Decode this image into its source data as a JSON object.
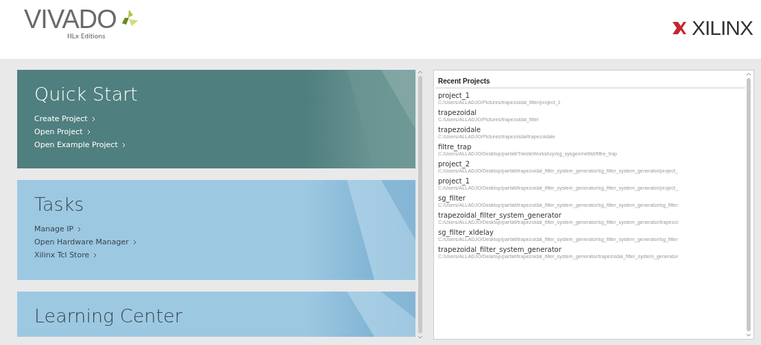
{
  "header": {
    "product": "VIVADO",
    "edition": "HLx Editions",
    "company": "XILINX"
  },
  "sections": [
    {
      "title": "Quick Start",
      "kind": "dark",
      "links": [
        "Create Project",
        "Open Project",
        "Open Example Project"
      ]
    },
    {
      "title": "Tasks",
      "kind": "light",
      "links": [
        "Manage IP",
        "Open Hardware Manager",
        "Xilinx Tcl Store"
      ]
    },
    {
      "title": "Learning Center",
      "kind": "light"
    }
  ],
  "recent_projects": {
    "title": "Recent Projects",
    "items": [
      {
        "name": "project_1",
        "path": "C:/Users/ALLADJO/Pictures/trapezoidal_filter/project_1"
      },
      {
        "name": "trapezoidal",
        "path": "C:/Users/ALLADJO/Pictures/trapezoidal_filter"
      },
      {
        "name": "trapezoidale",
        "path": "C:/Users/ALLADJO/Pictures/trapezoidal/trapezoidale"
      },
      {
        "name": "filtre_trap",
        "path": "C:/Users/ALLADJO/Desktop/parfait/TriesteWorkshop/sg_sysgen/netlist/filtre_trap"
      },
      {
        "name": "project_2",
        "path": "C:/Users/ALLADJO/Desktop/parfait/trapezoidal_filter_system_generator/sg_filter_system_generator/project_"
      },
      {
        "name": "project_1",
        "path": "C:/Users/ALLADJO/Desktop/parfait/trapezoidal_filter_system_generator/sg_filter_system_generator/project_"
      },
      {
        "name": "sg_filter",
        "path": "C:/Users/ALLADJO/Desktop/parfait/trapezoidal_filter_system_generator/sg_filter_system_generator/sg_filter"
      },
      {
        "name": "trapezoidal_filter_system_generator",
        "path": "C:/Users/ALLADJO/Desktop/parfait/trapezoidal_filter_system_generator/sg_filter_system_generator/trapezoi"
      },
      {
        "name": "sg_filter_xldelay",
        "path": "C:/Users/ALLADJO/Desktop/parfait/trapezoidal_filter_system_generator/sg_filter_system_generator/sg_filter"
      },
      {
        "name": "trapezoidal_filter_system_generator",
        "path": "C:/Users/ALLADJO/Desktop/parfait/trapezoidal_filter_system_generator/trapezoidal_filter_system_generator"
      }
    ]
  }
}
